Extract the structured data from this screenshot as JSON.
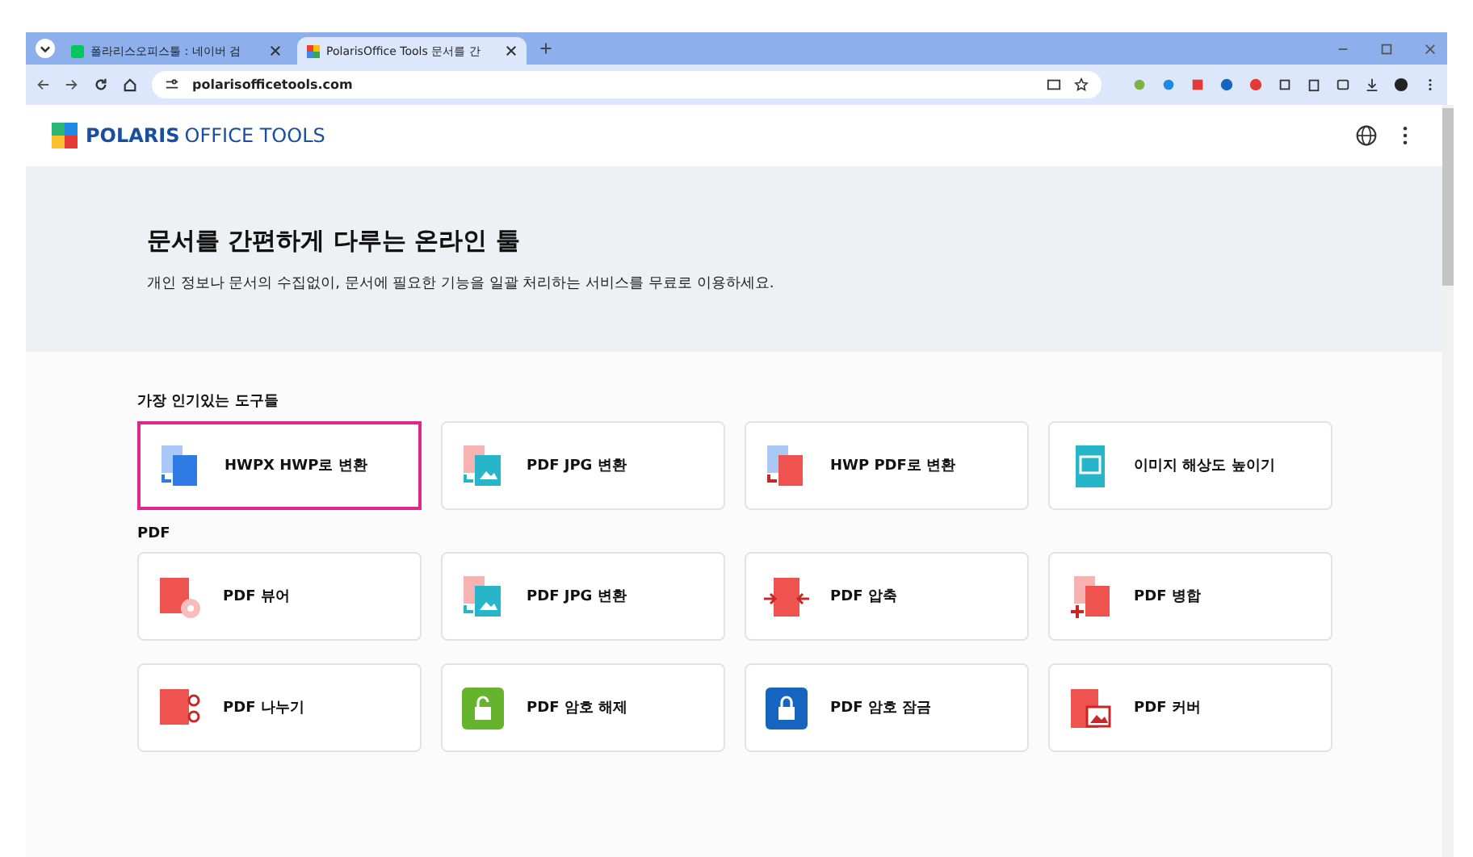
{
  "browser": {
    "tabs": [
      {
        "title": "폴라리스오피스툴 : 네이버 검",
        "selected": false
      },
      {
        "title": "PolarisOffice Tools 문서를 간",
        "selected": true
      }
    ],
    "address": "polarisofficetools.com"
  },
  "header": {
    "logo_bold": "POLARIS",
    "logo_light": "OFFICE TOOLS"
  },
  "hero": {
    "title": "문서를 간편하게 다루는 온라인 툴",
    "subtitle": "개인 정보나 문서의 수집없이, 문서에 필요한 기능을 일괄 처리하는 서비스를 무료로 이용하세요."
  },
  "sections": [
    {
      "title": "가장 인기있는 도구들",
      "cards": [
        {
          "label": "HWPX HWP로 변환",
          "kind": "hwpx-hwp",
          "selected": true
        },
        {
          "label": "PDF JPG 변환",
          "kind": "pdf-jpg",
          "selected": false
        },
        {
          "label": "HWP PDF로 변환",
          "kind": "hwp-pdf",
          "selected": false
        },
        {
          "label": "이미지 해상도 높이기",
          "kind": "upscale",
          "selected": false
        }
      ]
    },
    {
      "title": "PDF",
      "cards": [
        {
          "label": "PDF 뷰어",
          "kind": "viewer",
          "selected": false
        },
        {
          "label": "PDF JPG 변환",
          "kind": "pdf-jpg",
          "selected": false
        },
        {
          "label": "PDF 압축",
          "kind": "compress",
          "selected": false
        },
        {
          "label": "PDF 병합",
          "kind": "merge",
          "selected": false
        },
        {
          "label": "PDF 나누기",
          "kind": "split",
          "selected": false
        },
        {
          "label": "PDF 암호 해제",
          "kind": "unlock",
          "selected": false
        },
        {
          "label": "PDF 암호 잠금",
          "kind": "lock",
          "selected": false
        },
        {
          "label": "PDF 커버",
          "kind": "cover",
          "selected": false
        }
      ]
    }
  ]
}
